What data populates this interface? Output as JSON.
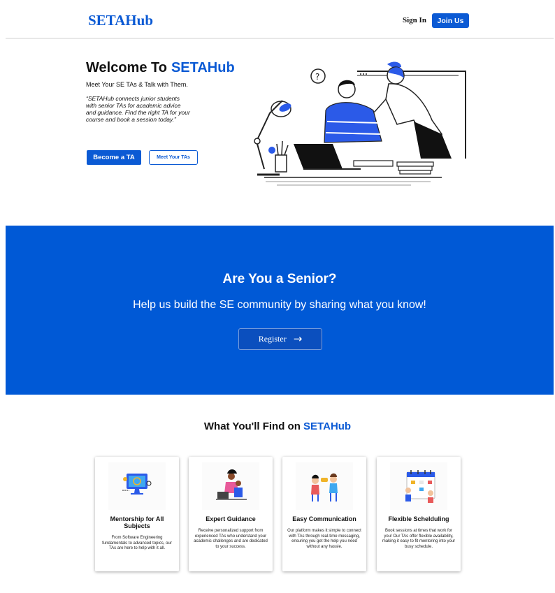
{
  "nav": {
    "brand": "SETAHub",
    "sign_in": "Sign In",
    "join_us": "Join Us"
  },
  "hero": {
    "title_prefix": "Welcome To",
    "title_accent": "SETAHub",
    "subtitle": "Meet Your SE TAs & Talk with Them.",
    "quote": "“SETAHub connects junior students with senior TAs for academic advice and guidance. Find the right TA for your course and book a session today.”",
    "primary_button": "Become a TA",
    "secondary_button": "Meet Your TAs"
  },
  "senior": {
    "title": "Are You a Senior?",
    "subtitle": "Help us build the SE community by sharing what you know!",
    "register": "Register"
  },
  "features": {
    "heading_prefix": "What You'll Find on",
    "heading_accent": "SETAHub",
    "cards": [
      {
        "title": "Mentorship for All Subjects",
        "desc": "From Software Engineering fundamentals to advanced topics, our TAs are here to help with it all.",
        "icon": "monitor-mentoring-icon"
      },
      {
        "title": "Expert Guidance",
        "desc": "Receive personalized support from experienced TAs who understand your academic challenges and are dedicated to your success.",
        "icon": "tutor-with-student-icon"
      },
      {
        "title": "Easy Communication",
        "desc": "Our platform makes it simple to connect with TAs through real-time messaging, ensuring you get the help you need without any hassle.",
        "icon": "two-people-chatting-icon"
      },
      {
        "title": "Flexible Schelduling",
        "desc": "Book sessions at times that work for you! Our TAs offer flexible availability, making it easy to fit mentoring into your busy schedule.",
        "icon": "calendar-scheduling-icon"
      }
    ]
  },
  "colors": {
    "accent": "#0b5ad4",
    "band": "#0059d6"
  }
}
